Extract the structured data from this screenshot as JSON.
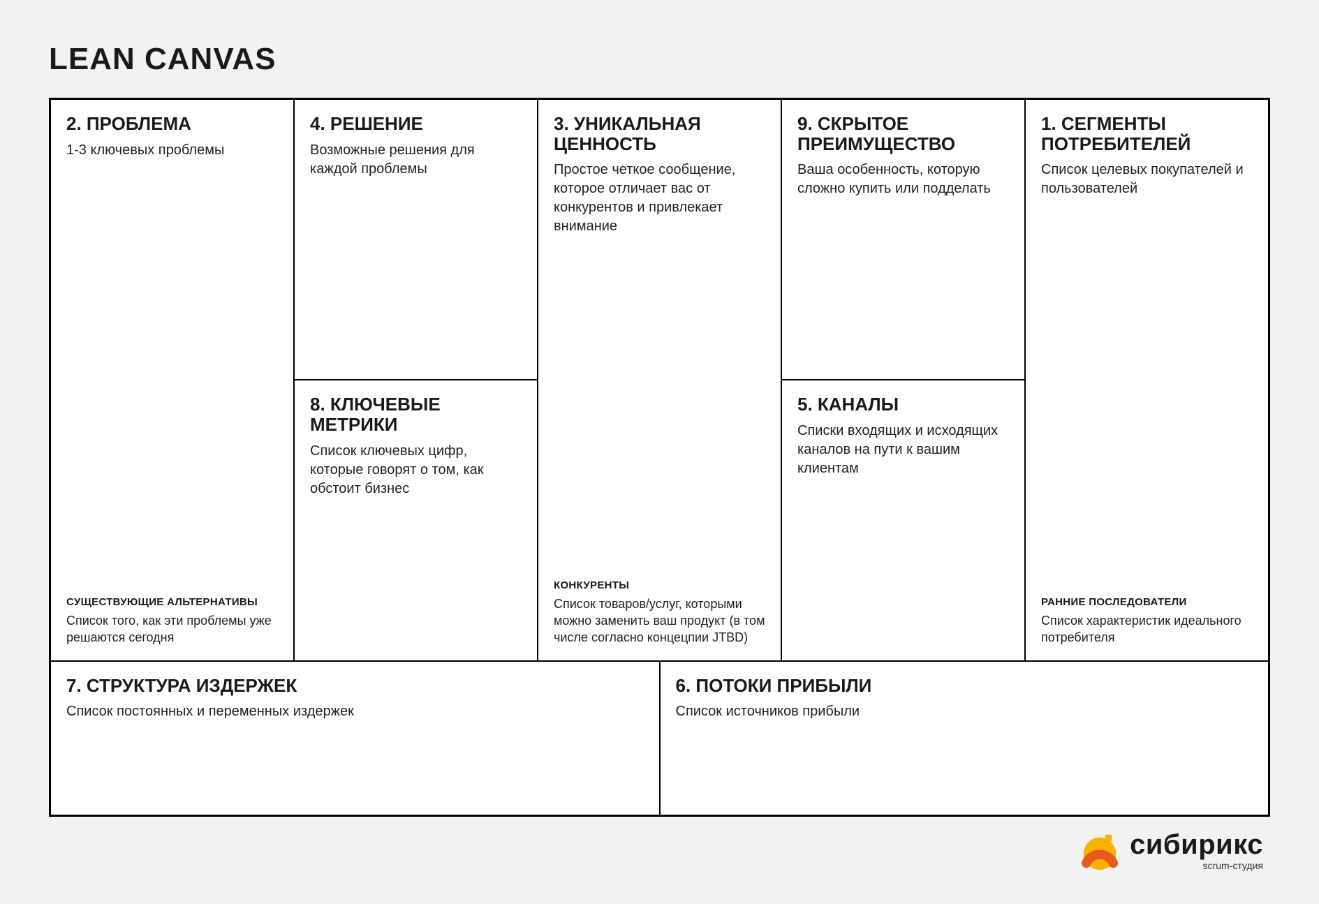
{
  "title": "LEAN CANVAS",
  "cells": {
    "problem": {
      "title": "2. ПРОБЛЕМА",
      "body": "1-3 ключевых проблемы",
      "sub_title": "СУЩЕСТВУЮЩИЕ АЛЬТЕРНАТИВЫ",
      "sub_body": "Список того, как эти проблемы уже решаются сегодня"
    },
    "solution": {
      "title": "4. РЕШЕНИЕ",
      "body": "Возможные решения для каждой проблемы"
    },
    "uvp": {
      "title": "3. УНИКАЛЬНАЯ ЦЕННОСТЬ",
      "body": "Простое четкое сообщение, которое отличает вас от конкурентов и привлекает внимание",
      "sub_title": "КОНКУРЕНТЫ",
      "sub_body": "Список товаров/услуг, которыми можно заменить ваш продукт (в том числе согласно концецпии JTBD)"
    },
    "advantage": {
      "title": "9. СКРЫТОЕ ПРЕИМУЩЕСТВО",
      "body": "Ваша особенность, которую сложно купить или подделать"
    },
    "segments": {
      "title": "1. СЕГМЕНТЫ ПОТРЕБИТЕЛЕЙ",
      "body": "Список целевых покупателей и пользователей",
      "sub_title": "РАННИЕ ПОСЛЕДОВАТЕЛИ",
      "sub_body": "Список характеристик идеального потребителя"
    },
    "metrics": {
      "title": "8. КЛЮЧЕВЫЕ МЕТРИКИ",
      "body": "Список ключевых цифр, которые говорят о том, как обстоит бизнес"
    },
    "channels": {
      "title": "5. КАНАЛЫ",
      "body": "Списки входящих и исходящих каналов на пути к вашим клиентам"
    },
    "costs": {
      "title": "7. СТРУКТУРА ИЗДЕРЖЕК",
      "body": "Список постоянных и переменных издержек"
    },
    "revenue": {
      "title": "6. ПОТОКИ ПРИБЫЛИ",
      "body": "Список источников прибыли"
    }
  },
  "logo": {
    "word": "сибирикс",
    "tagline": "scrum-студия"
  }
}
